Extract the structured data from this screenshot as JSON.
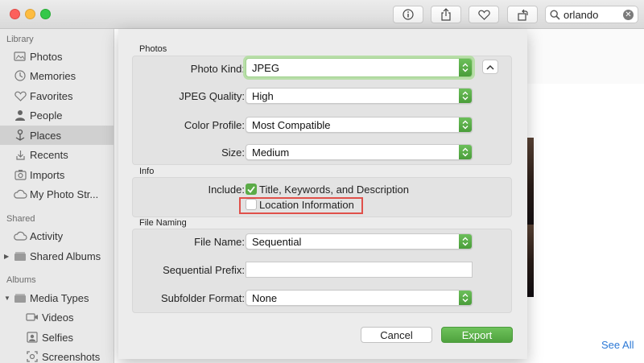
{
  "toolbar": {
    "buttons": [
      {
        "icon": "info-icon"
      },
      {
        "icon": "share-icon"
      },
      {
        "icon": "heart-icon"
      },
      {
        "icon": "rotate-icon"
      }
    ],
    "search": {
      "value": "orlando"
    }
  },
  "sidebar": {
    "sections": {
      "library": "Library",
      "shared": "Shared",
      "albums": "Albums"
    },
    "library_items": [
      {
        "label": "Photos",
        "icon": "photos-icon"
      },
      {
        "label": "Memories",
        "icon": "memories-icon"
      },
      {
        "label": "Favorites",
        "icon": "heart-icon"
      },
      {
        "label": "People",
        "icon": "person-icon"
      },
      {
        "label": "Places",
        "icon": "pin-icon"
      },
      {
        "label": "Recents",
        "icon": "recents-icon"
      },
      {
        "label": "Imports",
        "icon": "imports-icon"
      },
      {
        "label": "My Photo Str...",
        "icon": "cloud-icon"
      }
    ],
    "shared_items": [
      {
        "label": "Activity",
        "icon": "cloud-icon"
      },
      {
        "label": "Shared Albums",
        "icon": "folder-icon"
      }
    ],
    "album_items": [
      {
        "label": "Media Types",
        "icon": "folder-icon"
      },
      {
        "label": "Videos",
        "icon": "video-icon"
      },
      {
        "label": "Selfies",
        "icon": "selfie-icon"
      },
      {
        "label": "Screenshots",
        "icon": "screenshot-icon"
      }
    ]
  },
  "content": {
    "see_all": "See All"
  },
  "export_sheet": {
    "photos_section": "Photos",
    "photo_kind": {
      "label": "Photo Kind:",
      "value": "JPEG"
    },
    "jpeg_quality": {
      "label": "JPEG Quality:",
      "value": "High"
    },
    "color_profile": {
      "label": "Color Profile:",
      "value": "Most Compatible"
    },
    "size": {
      "label": "Size:",
      "value": "Medium"
    },
    "info_section": "Info",
    "include_label": "Include:",
    "include_title": {
      "label": "Title, Keywords, and Description",
      "checked": true
    },
    "include_location": {
      "label": "Location Information",
      "checked": false
    },
    "file_naming_section": "File Naming",
    "file_name": {
      "label": "File Name:",
      "value": "Sequential"
    },
    "sequential_prefix": {
      "label": "Sequential Prefix:",
      "value": ""
    },
    "subfolder_format": {
      "label": "Subfolder Format:",
      "value": "None"
    },
    "cancel_label": "Cancel",
    "export_label": "Export"
  },
  "colors": {
    "accent_green": "#5bab47",
    "highlight_red": "#e0504a",
    "link_blue": "#2b78d6"
  }
}
